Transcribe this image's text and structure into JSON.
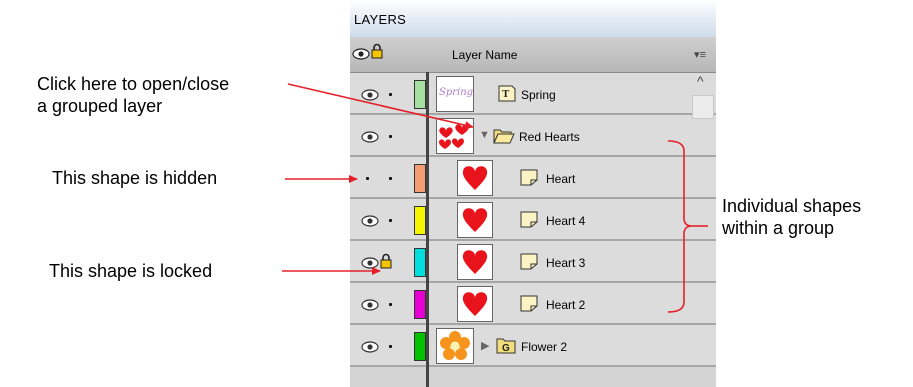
{
  "panel": {
    "title": "LAYERS",
    "column_header": "Layer Name"
  },
  "rows": [
    {
      "label": "Spring",
      "type": "text",
      "swatch": "#a6e0a0",
      "thumb_text": "Spring"
    },
    {
      "label": "Red Hearts",
      "type": "group-open"
    },
    {
      "label": "Heart",
      "type": "shape",
      "swatch": "#f29b75",
      "hidden": true
    },
    {
      "label": "Heart 4",
      "type": "shape",
      "swatch": "#f5f500"
    },
    {
      "label": "Heart 3",
      "type": "shape",
      "swatch": "#00dede",
      "locked": true
    },
    {
      "label": "Heart 2",
      "type": "shape",
      "swatch": "#e600d4"
    },
    {
      "label": "Flower 2",
      "type": "group-closed",
      "swatch": "#00c200"
    }
  ],
  "annotations": {
    "open_close_line1": "Click here to open/close",
    "open_close_line2": "a grouped layer",
    "hidden": "This shape is hidden",
    "locked": "This shape is locked",
    "group_line1": "Individual shapes",
    "group_line2": "within a group"
  },
  "colors": {
    "arrow": "#e5202a",
    "heart": "#e8131b",
    "folder": "#f2dc7c"
  }
}
